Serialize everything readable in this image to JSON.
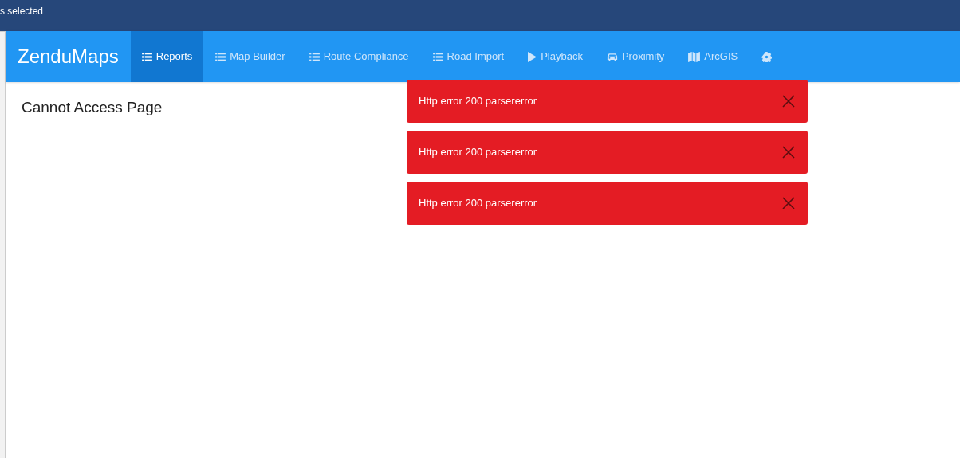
{
  "top_bar": {
    "text": "s selected"
  },
  "brand": "ZenduMaps",
  "nav": [
    {
      "label": "Reports",
      "kind": "list",
      "selected": true
    },
    {
      "label": "Map Builder",
      "kind": "list",
      "selected": false
    },
    {
      "label": "Route Compliance",
      "kind": "list",
      "selected": false
    },
    {
      "label": "Road Import",
      "kind": "list",
      "selected": false
    },
    {
      "label": "Playback",
      "kind": "play",
      "selected": false
    },
    {
      "label": "Proximity",
      "kind": "car",
      "selected": false
    },
    {
      "label": "ArcGIS",
      "kind": "map",
      "selected": false
    },
    {
      "kind": "gear",
      "selected": false
    }
  ],
  "page_title": "Cannot Access Page",
  "toasts": [
    {
      "message": "Http error 200 parsererror"
    },
    {
      "message": "Http error 200 parsererror"
    },
    {
      "message": "Http error 200 parsererror"
    }
  ]
}
